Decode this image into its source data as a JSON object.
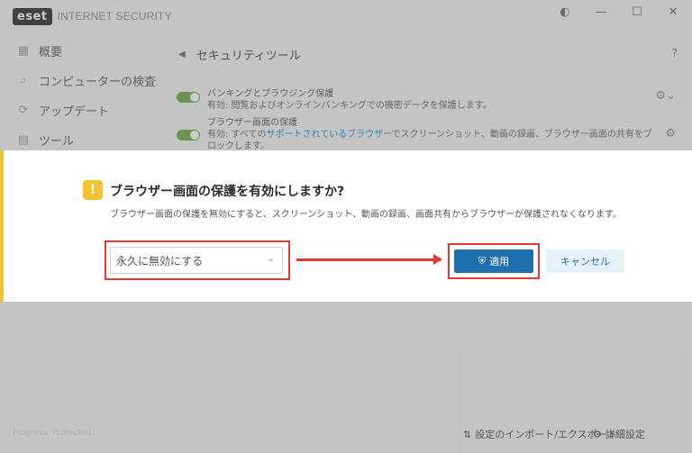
{
  "app": {
    "logo_mark": "eset",
    "product_name": "INTERNET SECURITY"
  },
  "window_controls": {
    "theme_icon": "◐",
    "minimize_icon": "—",
    "maximize_icon": "☐",
    "close_icon": "✕"
  },
  "sidebar": {
    "items": [
      {
        "label": "概要",
        "icon": "overview-icon",
        "glyph": "▦"
      },
      {
        "label": "コンピューターの検査",
        "icon": "search-icon",
        "glyph": "⌕"
      },
      {
        "label": "アップデート",
        "icon": "refresh-icon",
        "glyph": "⟳"
      },
      {
        "label": "ツール",
        "icon": "toolbox-icon",
        "glyph": "▤"
      }
    ]
  },
  "main": {
    "back_icon": "◀",
    "title": "セキュリティツール",
    "help": "?",
    "tools": [
      {
        "title": "バンキングとブラウジング保護",
        "desc": "有効: 閲覧およびオンラインバンキングでの機密データを保護します。",
        "gear_icon": "⚙⌄"
      },
      {
        "title": "ブラウザー画面の保護",
        "desc_prefix": "有効: すべての",
        "desc_link": "サポートされているブラウザー",
        "desc_suffix": "でスクリーンショット、動画の録画、ブラウザー画面の共有をブ",
        "desc_line2": "ロックします。",
        "gear_icon": "⚙"
      }
    ]
  },
  "dialog": {
    "warn_glyph": "!",
    "title": "ブラウザー画面の保護を有効にしますか?",
    "description": "ブラウザー画面の保護を無効にすると、スクリーンショット、動画の録画、画面共有からブラウザーが保護されなくなります。",
    "select_value": "永久に無効にする",
    "chevron": "⌄",
    "apply_icon": "⛨",
    "apply_label": "適用",
    "cancel_label": "キャンセル"
  },
  "footer": {
    "status": "Progress. Protected.",
    "import_icon": "⇅",
    "import_label": "設定のインポート/エクスポート",
    "settings_icon": "⚙",
    "settings_label": "詳細設定"
  },
  "colors": {
    "accent_blue": "#1e6fae",
    "toggle_green": "#6aa843",
    "warning_yellow": "#f2c230",
    "highlight_red": "#e53935"
  }
}
